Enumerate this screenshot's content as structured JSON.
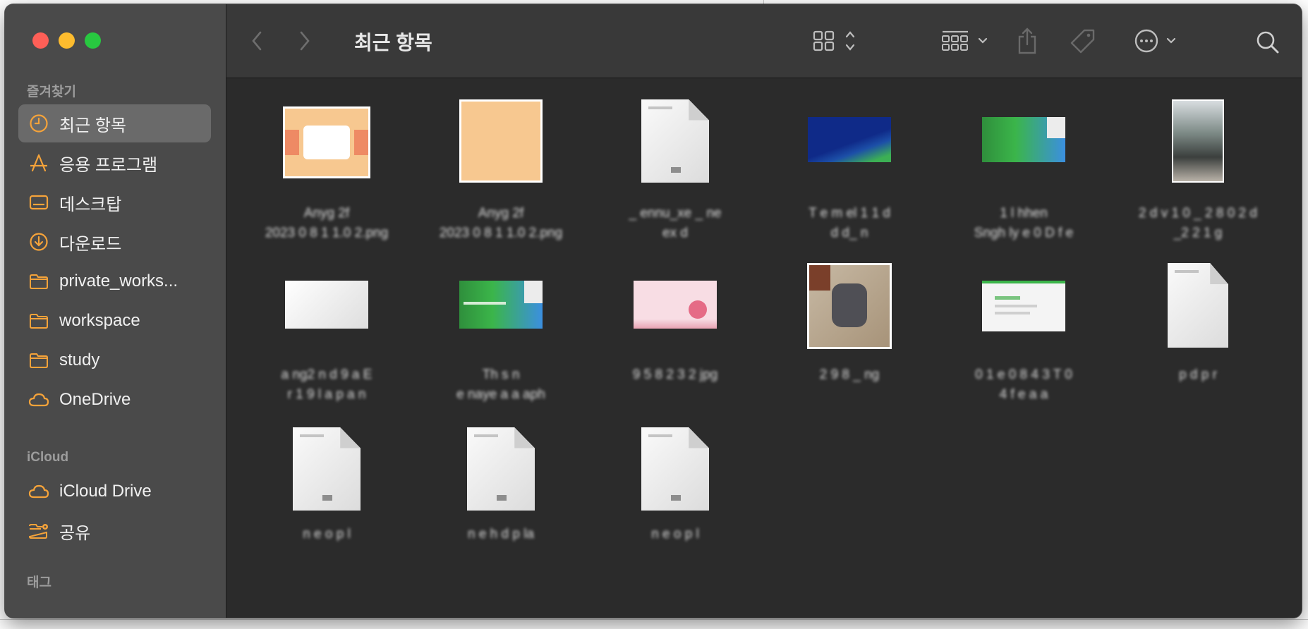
{
  "window": {
    "title": "최근 항목"
  },
  "sidebar": {
    "favorites_title": "즐겨찾기",
    "items": [
      {
        "label": "최근 항목",
        "icon": "clock-icon"
      },
      {
        "label": "응용 프로그램",
        "icon": "apps-icon"
      },
      {
        "label": "데스크탑",
        "icon": "desktop-icon"
      },
      {
        "label": "다운로드",
        "icon": "download-icon"
      },
      {
        "label": "private_works...",
        "icon": "folder-icon"
      },
      {
        "label": "workspace",
        "icon": "folder-icon"
      },
      {
        "label": "study",
        "icon": "folder-icon"
      },
      {
        "label": "OneDrive",
        "icon": "cloud-icon"
      }
    ],
    "icloud_title": "iCloud",
    "icloud_items": [
      {
        "label": "iCloud Drive",
        "icon": "cloud-icon"
      },
      {
        "label": "공유",
        "icon": "shared-folder-icon"
      }
    ],
    "tags_title": "태그"
  },
  "toolbar": {
    "back": "back-icon",
    "forward": "forward-icon",
    "view": "grid-view-icon",
    "group": "group-icon",
    "share": "share-icon",
    "tag": "tag-icon",
    "more": "ellipsis-icon",
    "search": "search-icon"
  },
  "colors": {
    "accent": "#f5a33a",
    "sidebar_bg": "#4a4a4a",
    "content_bg": "#2b2b2b"
  },
  "files": [
    {
      "name1": "Anyg 2f",
      "name2": "2023 0 8 1 1.0 2.png",
      "kind": "orange-slide"
    },
    {
      "name1": "Anyg 2f",
      "name2": "2023 0 8 1 1.0 2.png",
      "kind": "orange-blank"
    },
    {
      "name1": "_ ennu_xe _ ne",
      "name2": "ex d",
      "kind": "doc"
    },
    {
      "name1": "T e m el 1 1 d",
      "name2": "d d_ n",
      "kind": "blue-green"
    },
    {
      "name1": "1 l  hhen",
      "name2": "Sngh ly e 0 D f e",
      "kind": "green-blue"
    },
    {
      "name1": "2 d v 1 0 _ 2 8 0 2 d",
      "name2": "_2 2 1 g",
      "kind": "photo-tall"
    },
    {
      "name1": "a ng2 n d 9 a E",
      "name2": "r 1 9 l a p a n",
      "kind": "white-slide"
    },
    {
      "name1": "Th  s n",
      "name2": "e naye a  a aph",
      "kind": "green-blue-2"
    },
    {
      "name1": "9 5 8 2 3 2 jpg",
      "name2": "",
      "kind": "pink"
    },
    {
      "name1": "2 9 8 _ ng",
      "name2": "",
      "kind": "cat"
    },
    {
      "name1": "0 1 e 0 8 4 3 T 0",
      "name2": "4 f e  a a",
      "kind": "table-slide"
    },
    {
      "name1": "p  d  p  r",
      "name2": "",
      "kind": "doc-plain"
    },
    {
      "name1": "n e o p l",
      "name2": "",
      "kind": "doc"
    },
    {
      "name1": "n e h d p  la",
      "name2": "",
      "kind": "doc"
    },
    {
      "name1": "n e o p l",
      "name2": "",
      "kind": "doc"
    }
  ]
}
